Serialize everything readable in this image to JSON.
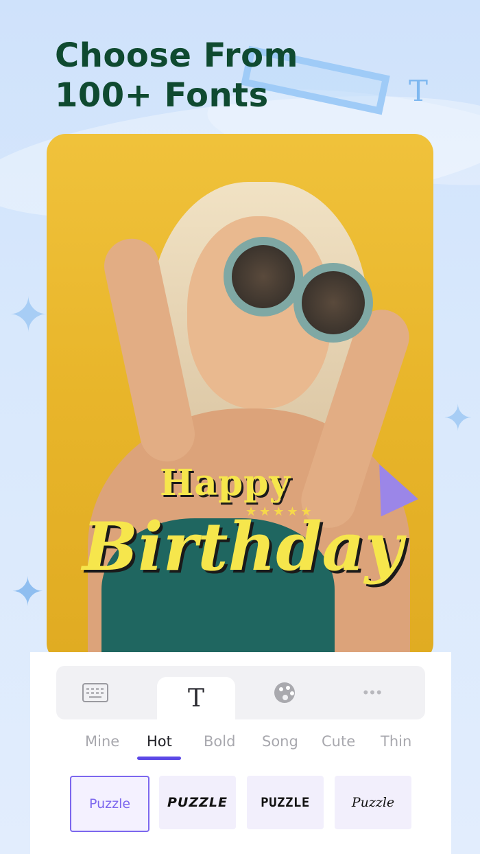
{
  "headline": {
    "line1": "Choose From",
    "line2": "100+ Fonts"
  },
  "sticker": {
    "happy": "Happy",
    "birthday": "Birthday"
  },
  "toolbar": {
    "tools": [
      {
        "icon": "keyboard-icon"
      },
      {
        "icon": "text-T-icon",
        "glyph": "T"
      },
      {
        "icon": "palette-icon"
      },
      {
        "icon": "more-icon",
        "glyph": "•••"
      }
    ],
    "active_index": 1
  },
  "categories": {
    "items": [
      "Mine",
      "Hot",
      "Bold",
      "Song",
      "Cute",
      "Thin"
    ],
    "active": "Hot"
  },
  "fonts": {
    "items": [
      "Puzzle",
      "PUZZLE",
      "PUZZLE",
      "Puzzle"
    ],
    "selected_index": 0
  },
  "colors": {
    "headline": "#0f4a30",
    "accent": "#5b48e6",
    "sticker_text": "#f6e64c"
  }
}
